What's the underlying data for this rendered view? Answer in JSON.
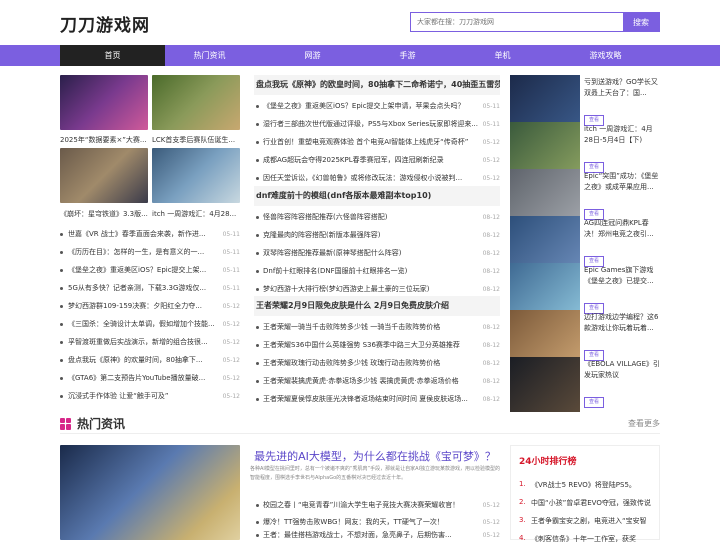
{
  "site": {
    "logo": "刀刀游戏网"
  },
  "search": {
    "placeholder": "大家都在搜：刀刀游戏网",
    "button": "搜索"
  },
  "nav": [
    "首页",
    "热门资讯",
    "网游",
    "手游",
    "单机",
    "游戏攻略"
  ],
  "featured": [
    {
      "caption": "2025年“数据要素×”大赛..."
    },
    {
      "caption": "LCK首支季后赛队伍诞生..."
    },
    {
      "caption": "《崩坏：星穹铁道》3.3版..."
    },
    {
      "caption": "itch 一周游戏汇：4月28..."
    }
  ],
  "left_list": [
    {
      "title": "世嘉《VR 战士》春季直面会来袭，新作进...",
      "date": "05-11"
    },
    {
      "title": "《历历在目》：怎样的一生，是有意义的一...",
      "date": "05-11"
    },
    {
      "title": "《堡垒之夜》重返美区iOS？Epic提交上架...",
      "date": "05-11"
    },
    {
      "title": "5G从有多快？记者亲测，下载3.3G游戏仅...",
      "date": "05-11"
    },
    {
      "title": "梦幻西游群109-159决赛：夕阳红全力夺...",
      "date": "05-12"
    },
    {
      "title": "《三国杀：全骑设计太单调，假如增加个技能...",
      "date": "05-12"
    },
    {
      "title": "孚智渡斑重做后实战演示，新增的组合技很...",
      "date": "05-12"
    },
    {
      "title": "盘点我玩《原神》的欢量时间，80抽拿下...",
      "date": "05-12"
    },
    {
      "title": "《GTA6》第二支预告片YouTube播放量破...",
      "date": "05-12"
    },
    {
      "title": "沉浸式手作体验 让爱“触手可及”",
      "date": "05-12"
    }
  ],
  "mid_sections": [
    {
      "head": "盘点我玩《原神》的欧皇时间，80抽拿下二命希诺宁，40抽歪五雷莎",
      "rows": [
        {
          "title": "《堡垒之夜》重返美区iOS？Epic提交上架申请，苹果会点头吗？",
          "date": "05-11"
        },
        {
          "title": "湿行者三部曲次世代版通过评级，PS5与Xbox Series玩家即将迎来...",
          "date": "05-11"
        },
        {
          "title": "行业首创！重塑电竞观赛体验 首个电竞AI智能体上线虎牙“传奇杯”",
          "date": "05-12"
        },
        {
          "title": "成都AG超玩会夺得2025KPL春季赛冠军，四连冠刷新纪录",
          "date": "05-12"
        },
        {
          "title": "因任天堂诉讼，《幻兽帕鲁》或将修改玩法：游戏侵权小说被判...",
          "date": "05-12"
        }
      ]
    },
    {
      "head": "dnf难度前十的模组(dnf各版本最难副本top10)",
      "rows": [
        {
          "title": "怪兽阵容阵容搭配推荐(六怪兽阵容搭配)",
          "date": "08-12"
        },
        {
          "title": "克隆最肉的阵容搭配(新版本最强阵容)",
          "date": "08-12"
        },
        {
          "title": "双琴阵容搭配推荐最新(原神琴搭配什么阵容)",
          "date": "08-12"
        },
        {
          "title": "Dnf前十红眼排名(DNF国服前十红眼排名一览)",
          "date": "08-12"
        },
        {
          "title": "梦幻西游十大排行榜(梦幻西游史上最土豪的三位玩家)",
          "date": "08-12"
        }
      ]
    },
    {
      "head": "王者荣耀2月9日限免皮肤是什么 2月9日免费皮肤介绍",
      "rows": [
        {
          "title": "王者荣耀一骑当千击败阵势多少钱 一骑当千击败阵势价格",
          "date": "08-12"
        },
        {
          "title": "王者荣耀S36中国什么英雄强势 S36赛季中路三大卫分英雄推荐",
          "date": "08-12"
        },
        {
          "title": "王者荣耀玫瑰行动击败阵势多少钱 玫瑰行动击败阵势价格",
          "date": "08-12"
        },
        {
          "title": "王者荣耀裴擒虎黄虎·赤拳返场多少钱 裴擒虎黄虎·赤拳返场价格",
          "date": "08-12"
        },
        {
          "title": "王者荣耀夏侯惇皮肤匪光决锋者返场结束时间时间 夏侯皮肤返场...",
          "date": "08-12"
        }
      ]
    }
  ],
  "right_list": [
    {
      "title": "亏到送游戏？GO学长又双叒上天台了：国...",
      "btn": "查看",
      "color": "#1c2a4a"
    },
    {
      "title": "itch 一周游戏汇：4月28日-5月4日【下)",
      "btn": "查看",
      "color": "#3a5a3c"
    },
    {
      "title": "Epic“突围”成功：《堡垒之夜》或成苹果应用...",
      "btn": "查看",
      "color": "#5f646c"
    },
    {
      "title": "AG四连冠问鼎KPL春决！郑州电竞之夜引...",
      "btn": "查看",
      "color": "#2d4f7a"
    },
    {
      "title": "Epic Games旗下游戏《堡垒之夜》已提交...",
      "btn": "查看",
      "color": "#3f6a93"
    },
    {
      "title": "边打游戏边学编程？这6款游戏让你玩着玩着...",
      "btn": "查看",
      "color": "#7c5a3a"
    },
    {
      "title": "《EBOLA VILLAGE》引发玩家热议",
      "btn": "查看",
      "color": "#1a1d24"
    }
  ],
  "hot": {
    "section_title": "热门资讯",
    "more": "查看更多",
    "title": "最先进的AI大模型，为什么都在挑战《宝可梦》？",
    "desc": "各种AI模型在挑间里时，总有一个被诸不爽的“秀肌肉”手段，那就是让自家AI独立游玩某款游戏，用以检验模型的智能程度，围棋选手李世石与AlphaGo的五番棋对决已经过去近十年。",
    "list": [
      {
        "title": "校园之春丨“电竞青春”川渝大学生电子竞技大赛决赛荣耀收官！",
        "date": "05-12"
      },
      {
        "title": "爆冷！TT强势击败WBG！网友：我的天，TT硬气了一次！",
        "date": "05-12"
      },
      {
        "title": "王者：最佳搭档游戏战士，不想对面，急亮鼻子，后期伤害...",
        "date": "05-12"
      }
    ],
    "rank_title": "24小时排行榜",
    "rank": [
      {
        "n": "1.",
        "title": "《VR战士5 REVO》将登陆PS5。"
      },
      {
        "n": "2.",
        "title": "中国“小孩”曾卓君EVO夺冠，强致传说"
      },
      {
        "n": "3.",
        "title": "王者争霸宝安之剧，电竞进入“宝安智"
      },
      {
        "n": "4.",
        "title": "《刺客信条》十年一工作室，获奖"
      }
    ]
  }
}
